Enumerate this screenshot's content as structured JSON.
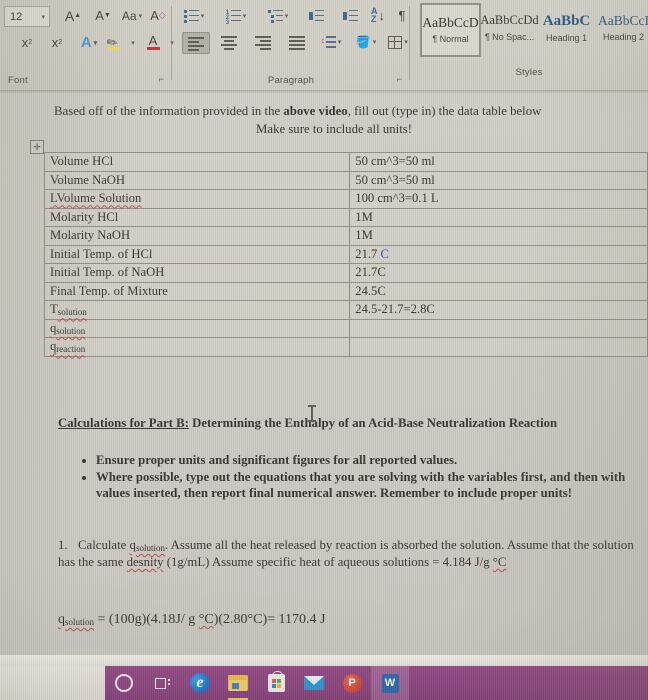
{
  "app": {
    "name": "Microsoft Word",
    "platform": "Windows 10"
  },
  "ribbon": {
    "groups": [
      {
        "label": "Font"
      },
      {
        "label": "Paragraph"
      },
      {
        "label": "Styles"
      }
    ],
    "font_group": {
      "label": "Font",
      "font_size_value": "12",
      "grow_font_label": "A",
      "shrink_font_label": "A",
      "change_case_label": "Aa",
      "clear_formatting_label": "A",
      "subscript_label": "x",
      "subscript_sub": "2",
      "superscript_label": "x",
      "superscript_sup": "2",
      "text_effects_label": "A",
      "highlight_label": "",
      "font_color_label": "A",
      "dialog_launcher": "⌐"
    },
    "paragraph_group": {
      "label": "Paragraph",
      "sort_label": "A\nZ",
      "show_marks_label": "¶",
      "dialog_launcher": "⌐"
    },
    "styles_group": {
      "label": "Styles",
      "items": [
        {
          "preview": "AaBbCcD",
          "name": "¶ Normal",
          "selected": true,
          "kind": "normal"
        },
        {
          "preview": "AaBbCcDd",
          "name": "¶ No Spac...",
          "selected": false,
          "kind": "normal"
        },
        {
          "preview": "AaBbC",
          "name": "Heading 1",
          "selected": false,
          "kind": "h1"
        },
        {
          "preview": "AaBbCcI",
          "name": "Heading 2",
          "selected": false,
          "kind": "h2"
        }
      ]
    }
  },
  "document": {
    "intro": {
      "line1_a": "Based off of the information provided in the ",
      "line1_bold": "above video",
      "line1_b": ", fill out (type in) the data table below",
      "line2": "Make sure to include all units!"
    },
    "table": {
      "rows": [
        {
          "label": "Volume HCl",
          "label_sub": "",
          "value": "50 cm^3=50 ml",
          "value_blue": ""
        },
        {
          "label": "Volume NaOH",
          "label_sub": "",
          "value": "50 cm^3=50 ml",
          "value_blue": ""
        },
        {
          "label": "LVolume Solution",
          "label_sub": "",
          "value": "100 cm^3=0.1 L",
          "value_blue": ""
        },
        {
          "label": "Molarity HCl",
          "label_sub": "",
          "value": "1M",
          "value_blue": ""
        },
        {
          "label": "Molarity NaOH",
          "label_sub": "",
          "value": "1M",
          "value_blue": ""
        },
        {
          "label": "Initial Temp. of HCl",
          "label_sub": "",
          "value": "21.7 ",
          "value_blue": "C"
        },
        {
          "label": "Initial Temp. of NaOH",
          "label_sub": "",
          "value": "21.7C",
          "value_blue": ""
        },
        {
          "label": "Final Temp. of Mixture",
          "label_sub": "",
          "value": "24.5C",
          "value_blue": ""
        },
        {
          "label": "T",
          "label_sub": "solution",
          "value": "24.5-21.7=2.8C",
          "value_blue": ""
        },
        {
          "label": "q",
          "label_sub": "solution",
          "value": "",
          "value_blue": ""
        },
        {
          "label": "q",
          "label_sub": "reaction",
          "value": "",
          "value_blue": ""
        }
      ]
    },
    "calculations": {
      "heading_underlined": "Calculations for Part B:",
      "heading_rest": "  Determining the Enthalpy of an Acid-Base Neutralization Reaction",
      "bullets": [
        "Ensure proper units and significant figures for all reported values.",
        "Where possible, type out the equations that you are solving with the variables first, and then with values inserted, then report final numerical answer. Remember to include proper units!"
      ],
      "numbered": [
        {
          "number": "1.",
          "part_a": "Calculate ",
          "var_main": "q",
          "var_sub": "solution",
          "part_b": ". Assume all the heat released by reaction is absorbed the solution.  Assume that the solution has the same ",
          "misspelled": "desnity",
          "part_c": " (1g/mL) Assume specific heat of aqueous solutions = 4.184 J/g ",
          "degc": "°C"
        }
      ],
      "equation": {
        "var_main": "q",
        "var_sub": "solution",
        "rest": " = (100g)(4.18J/ g ",
        "degc1": "°C",
        "rest2": ")(2.80°C)= 1170.4 J"
      }
    }
  },
  "taskbar": {
    "items": [
      {
        "name": "cortana",
        "label": "Cortana",
        "highlighted": false
      },
      {
        "name": "task-view",
        "label": "Task View",
        "highlighted": false
      },
      {
        "name": "edge",
        "label": "Microsoft Edge",
        "glyph": "e",
        "highlighted": false
      },
      {
        "name": "file-explorer",
        "label": "File Explorer",
        "highlighted": false
      },
      {
        "name": "microsoft-store",
        "label": "Microsoft Store",
        "highlighted": false
      },
      {
        "name": "mail",
        "label": "Mail",
        "highlighted": false
      },
      {
        "name": "powerpoint",
        "label": "PowerPoint",
        "glyph": "P",
        "highlighted": false
      },
      {
        "name": "word",
        "label": "Word",
        "glyph": "W",
        "highlighted": true
      }
    ],
    "accent_color": "#873a7b"
  }
}
